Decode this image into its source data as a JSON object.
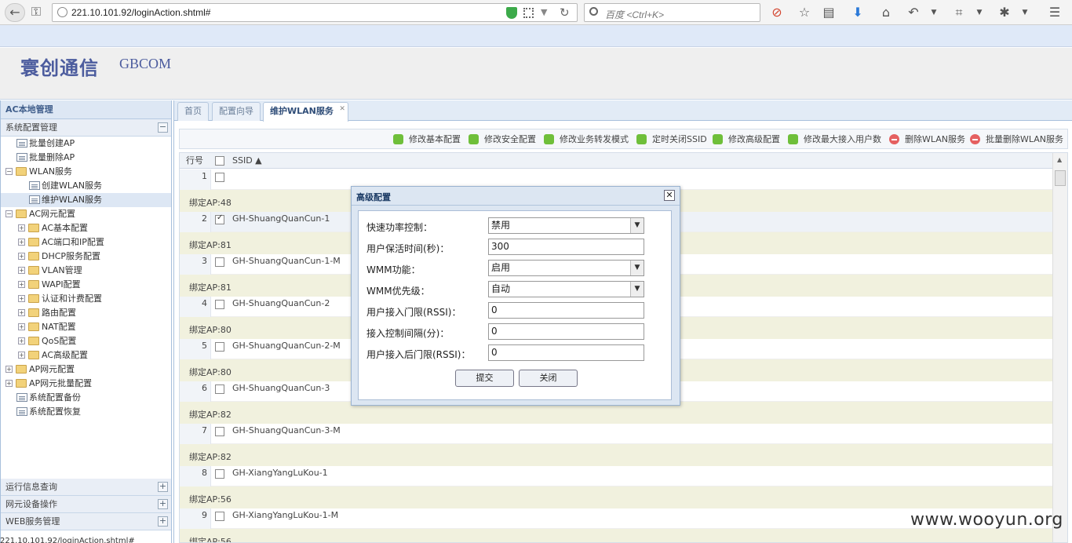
{
  "browser": {
    "url": "221.10.101.92/loginAction.shtml#",
    "search_placeholder": "百度 <Ctrl+K>",
    "status_url": "221.10.101.92/loginAction.shtml#"
  },
  "header": {
    "brand_cn": "寰创通信",
    "brand_en": "GBCOM"
  },
  "sidebar": {
    "title": "AC本地管理",
    "panel_title": "系统配置管理",
    "tree": [
      {
        "label": "批量创建AP"
      },
      {
        "label": "批量删除AP"
      },
      {
        "label": "WLAN服务"
      },
      {
        "label": "创建WLAN服务"
      },
      {
        "label": "维护WLAN服务"
      },
      {
        "label": "AC网元配置"
      },
      {
        "label": "AC基本配置"
      },
      {
        "label": "AC端口和IP配置"
      },
      {
        "label": "DHCP服务配置"
      },
      {
        "label": "VLAN管理"
      },
      {
        "label": "WAPI配置"
      },
      {
        "label": "认证和计费配置"
      },
      {
        "label": "路由配置"
      },
      {
        "label": "NAT配置"
      },
      {
        "label": "QoS配置"
      },
      {
        "label": "AC高级配置"
      },
      {
        "label": "AP网元配置"
      },
      {
        "label": "AP网元批量配置"
      },
      {
        "label": "系统配置备份"
      },
      {
        "label": "系统配置恢复"
      }
    ],
    "bottom_panels": [
      "运行信息查询",
      "网元设备操作",
      "WEB服务管理"
    ]
  },
  "tabs": [
    "首页",
    "配置向导",
    "维护WLAN服务"
  ],
  "toolbar": [
    "修改基本配置",
    "修改安全配置",
    "修改业务转发模式",
    "定时关闭SSID",
    "修改高级配置",
    "修改最大接入用户数",
    "删除WLAN服务",
    "批量删除WLAN服务"
  ],
  "grid": {
    "col_rownum": "行号",
    "col_ssid": "SSID ▲",
    "rows": [
      {
        "num": "1",
        "ssid": "",
        "detail": "绑定AP:48"
      },
      {
        "num": "2",
        "ssid": "GH-ShuangQuanCun-1",
        "detail": "绑定AP:81"
      },
      {
        "num": "3",
        "ssid": "GH-ShuangQuanCun-1-M",
        "detail": "绑定AP:81"
      },
      {
        "num": "4",
        "ssid": "GH-ShuangQuanCun-2",
        "detail": "绑定AP:80"
      },
      {
        "num": "5",
        "ssid": "GH-ShuangQuanCun-2-M",
        "detail": "绑定AP:80"
      },
      {
        "num": "6",
        "ssid": "GH-ShuangQuanCun-3",
        "detail": "绑定AP:82"
      },
      {
        "num": "7",
        "ssid": "GH-ShuangQuanCun-3-M",
        "detail": "绑定AP:82"
      },
      {
        "num": "8",
        "ssid": "GH-XiangYangLuKou-1",
        "detail": "绑定AP:56"
      },
      {
        "num": "9",
        "ssid": "GH-XiangYangLuKou-1-M",
        "detail": "绑定AP:56"
      }
    ]
  },
  "dialog": {
    "title": "高级配置",
    "fields": [
      {
        "label": "快速功率控制：",
        "value": "禁用"
      },
      {
        "label": "用户保活时间(秒)：",
        "value": "300"
      },
      {
        "label": "WMM功能：",
        "value": "启用"
      },
      {
        "label": "WMM优先级：",
        "value": "自动"
      },
      {
        "label": "用户接入门限(RSSI)：",
        "value": "0"
      },
      {
        "label": "接入控制间隔(分)：",
        "value": "0"
      },
      {
        "label": "用户接入后门限(RSSI)：",
        "value": "0"
      }
    ],
    "submit": "提交",
    "close": "关闭"
  },
  "watermark": "www.wooyun.org"
}
